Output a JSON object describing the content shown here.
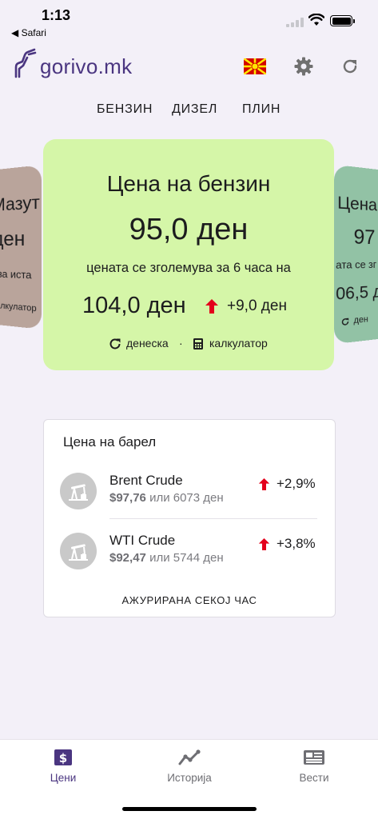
{
  "status_bar": {
    "time": "1:13",
    "back_label": "◀ Safari"
  },
  "header": {
    "logo_text": "gorivo.mk",
    "accent_color": "#4a3580"
  },
  "fuel_tabs": [
    {
      "label": "БЕНЗИН"
    },
    {
      "label": "ДИЗЕЛ"
    },
    {
      "label": "ПЛИН"
    }
  ],
  "left_card": {
    "title": "Мазут",
    "price": "ден",
    "note": "ва иста",
    "link": "калкулатор",
    "color": "#b9a49b"
  },
  "right_card": {
    "title": "Цена на",
    "price": "97",
    "note": "ата се зг",
    "future": "06,5 д",
    "link": "ден",
    "color": "#92c2a5"
  },
  "main_card": {
    "title": "Цена на бензин",
    "price": "95,0 ден",
    "note": "цената се зголемува за 6 часа на",
    "future_price": "104,0 ден",
    "future_diff": "+9,0 ден",
    "link_today": "денеска",
    "link_separator": "·",
    "link_calculator": "калкулатор",
    "color": "#d5f6a8"
  },
  "barrel": {
    "title": "Цена на барел",
    "items": [
      {
        "name": "Brent Crude",
        "usd": "$97,76",
        "or": "или",
        "mkd": "6073 ден",
        "change": "+2,9%"
      },
      {
        "name": "WTI Crude",
        "usd": "$92,47",
        "or": "или",
        "mkd": "5744 ден",
        "change": "+3,8%"
      }
    ],
    "footer": "АЖУРИРАНА СЕКОЈ ЧАС"
  },
  "bottom_nav": [
    {
      "label": "Цени",
      "icon": "dollar-icon",
      "active": true
    },
    {
      "label": "Историја",
      "icon": "chart-line-icon",
      "active": false
    },
    {
      "label": "Вести",
      "icon": "news-icon",
      "active": false
    }
  ],
  "colors": {
    "up_arrow": "#e3001b",
    "nav_active": "#4a3580",
    "nav_inactive": "#6e6e73"
  }
}
